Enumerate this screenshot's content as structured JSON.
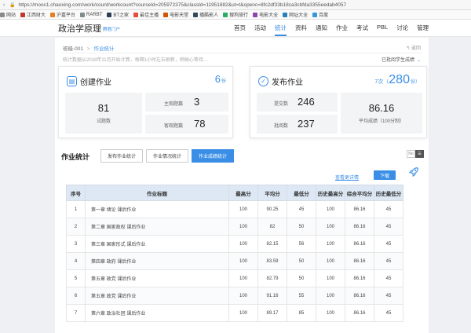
{
  "browser": {
    "url": "https://mooc1.chaoxing.com/work/count/workcount?courseId=205972375&classId=11951882&ut=t&openc=8fc2df33b18ca3cbfda3355eedab4057",
    "bookmarks": [
      {
        "label": "网站",
        "color": "#8a8a8a"
      },
      {
        "label": "江西财大",
        "color": "#c0392b"
      },
      {
        "label": "沪嘉平台",
        "color": "#e67e22"
      },
      {
        "label": "RARBT",
        "color": "#7f8c8d"
      },
      {
        "label": "BT之家",
        "color": "#2c3e50"
      },
      {
        "label": "最佳主播",
        "color": "#e74c3c"
      },
      {
        "label": "电影天堂",
        "color": "#d35400"
      },
      {
        "label": "播酷影人",
        "color": "#34495e"
      },
      {
        "label": "搜狗旅行",
        "color": "#27ae60"
      },
      {
        "label": "电影大全",
        "color": "#8e44ad"
      },
      {
        "label": "网址大全",
        "color": "#2980b9"
      },
      {
        "label": "百度",
        "color": "#3498db"
      }
    ]
  },
  "header": {
    "course_title": "政治学原理",
    "course_sub": "腾君门户",
    "nav": [
      {
        "label": "首页",
        "active": false
      },
      {
        "label": "活动",
        "active": false
      },
      {
        "label": "统计",
        "active": true
      },
      {
        "label": "资料",
        "active": false
      },
      {
        "label": "通知",
        "active": false
      },
      {
        "label": "作业",
        "active": false
      },
      {
        "label": "考试",
        "active": false
      },
      {
        "label": "PBL",
        "active": false
      },
      {
        "label": "讨论",
        "active": false
      },
      {
        "label": "管理",
        "active": false
      }
    ]
  },
  "breadcrumb": {
    "class": "班级-001",
    "sep": ">",
    "current": "作业统计"
  },
  "back": "↰ 返回",
  "notice": "统计数据从2018年11月开始计算，每隔1小时左右刷新，稍候心等待…",
  "view_select": {
    "label": "已批阅学生成绩",
    "chev": "⌄"
  },
  "create_card": {
    "title": "创建作业",
    "icon": "📄",
    "count": "6",
    "unit": "份",
    "stats": [
      {
        "value": "81",
        "label": "试题数"
      },
      {
        "value": "3",
        "label": "主观题篇"
      },
      {
        "value": "78",
        "label": "客观题篇"
      }
    ]
  },
  "publish_card": {
    "title": "发布作业",
    "icon": "✓",
    "count_pre": "7次（",
    "count": "280",
    "unit": "份）",
    "stats": [
      {
        "value": "246",
        "label": "提交数"
      },
      {
        "value": "237",
        "label": "批阅数"
      },
      {
        "value": "86.16",
        "label": "平均成绩（100分制）"
      }
    ]
  },
  "section": {
    "title": "作业统计",
    "tabs": [
      {
        "label": "发布作业统计",
        "active": false
      },
      {
        "label": "作业情况统计",
        "active": false
      },
      {
        "label": "作业成绩统计",
        "active": true
      }
    ],
    "toggle": [
      {
        "label": "No",
        "active": false
      },
      {
        "label": "☰",
        "active": true
      }
    ],
    "detail_link": "查看更详情",
    "download": "下载"
  },
  "table": {
    "headers": [
      "序号",
      "作业标题",
      "最高分",
      "平均分",
      "最低分",
      "历史最高分",
      "综合平均分",
      "历史最低分"
    ],
    "rows": [
      [
        "1",
        "第一章 绪论 课后作业",
        "100",
        "90.25",
        "45",
        "100",
        "86.16",
        "45"
      ],
      [
        "2",
        "第二章 国家政权 课后作业",
        "100",
        "82",
        "50",
        "100",
        "86.16",
        "45"
      ],
      [
        "3",
        "第三章 国家形式 课后作业",
        "100",
        "82.15",
        "56",
        "100",
        "86.16",
        "45"
      ],
      [
        "4",
        "第四章 政府 课后作业",
        "100",
        "83.59",
        "50",
        "100",
        "86.16",
        "45"
      ],
      [
        "5",
        "第五章 政党 课后作业",
        "100",
        "82.79",
        "50",
        "100",
        "86.16",
        "45"
      ],
      [
        "6",
        "第五章 政党 课后作业",
        "100",
        "91.16",
        "55",
        "100",
        "86.16",
        "45"
      ],
      [
        "7",
        "第六章 政治社团 课后作业",
        "100",
        "89.17",
        "85",
        "100",
        "86.16",
        "45"
      ]
    ]
  }
}
